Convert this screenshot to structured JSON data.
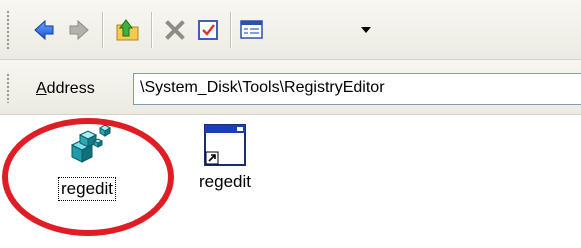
{
  "toolbar": {
    "buttons": [
      {
        "name": "back-button",
        "icon": "back-arrow-icon"
      },
      {
        "name": "forward-button",
        "icon": "forward-arrow-icon"
      },
      {
        "name": "up-folder-button",
        "icon": "up-folder-icon"
      },
      {
        "name": "delete-button",
        "icon": "delete-x-icon"
      },
      {
        "name": "properties-button",
        "icon": "properties-check-icon"
      },
      {
        "name": "views-button",
        "icon": "views-icon"
      }
    ]
  },
  "address": {
    "label_accel": "A",
    "label_rest": "ddress",
    "value": "\\System_Disk\\Tools\\RegistryEditor"
  },
  "files": [
    {
      "label": "regedit",
      "icon": "registry-cubes-icon",
      "selected_focus": true
    },
    {
      "label": "regedit",
      "icon": "shortcut-window-icon",
      "selected_focus": false
    }
  ],
  "colors": {
    "highlight_ring": "#e01d24",
    "toolbar_bg": "#ecebe3",
    "address_border": "#7f9db9"
  }
}
